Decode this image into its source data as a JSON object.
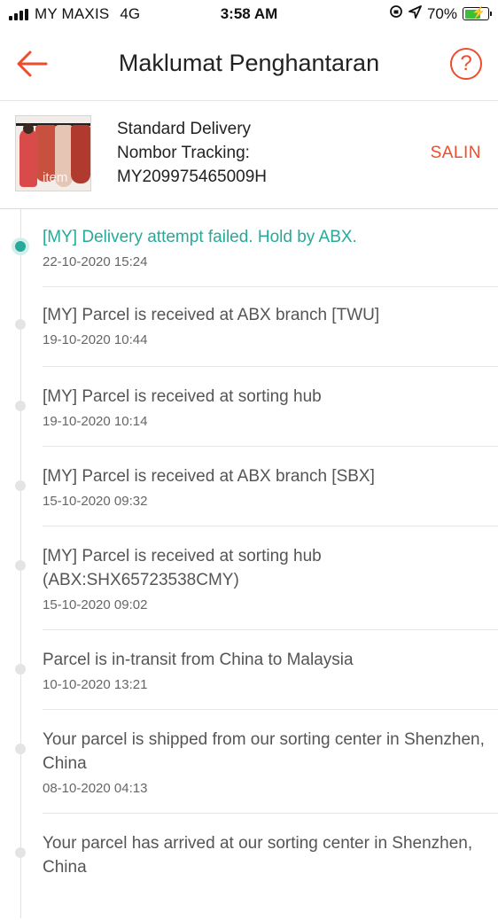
{
  "status_bar": {
    "carrier": "MY MAXIS",
    "network": "4G",
    "time": "3:58 AM",
    "battery": "70%",
    "battery_level": 0.7
  },
  "header": {
    "title": "Maklumat Penghantaran",
    "help_symbol": "?"
  },
  "shipment": {
    "service": "Standard Delivery",
    "tracking_label": "Nombor Tracking:",
    "tracking_number": "MY209975465009H",
    "copy_label": "SALIN",
    "thumbnail_watermark": "item"
  },
  "timeline": [
    {
      "description": "[MY] Delivery attempt failed. Hold by ABX.",
      "time": "22-10-2020 15:24",
      "active": true
    },
    {
      "description": "[MY] Parcel is received at ABX branch [TWU]",
      "time": "19-10-2020 10:44",
      "active": false
    },
    {
      "description": "[MY] Parcel is received at sorting hub",
      "time": "19-10-2020 10:14",
      "active": false
    },
    {
      "description": "[MY] Parcel is received at ABX branch [SBX]",
      "time": "15-10-2020 09:32",
      "active": false
    },
    {
      "description": "[MY] Parcel is received at sorting hub (ABX:SHX65723538CMY)",
      "time": "15-10-2020 09:02",
      "active": false
    },
    {
      "description": "Parcel is in-transit from China to Malaysia",
      "time": "10-10-2020 13:21",
      "active": false
    },
    {
      "description": "Your parcel is shipped from our sorting center in Shenzhen, China",
      "time": "08-10-2020 04:13",
      "active": false
    },
    {
      "description": "Your parcel has arrived at our sorting center in Shenzhen, China",
      "time": "",
      "active": false
    }
  ],
  "colors": {
    "accent": "#ee4d2d",
    "active_event": "#26aa99"
  }
}
